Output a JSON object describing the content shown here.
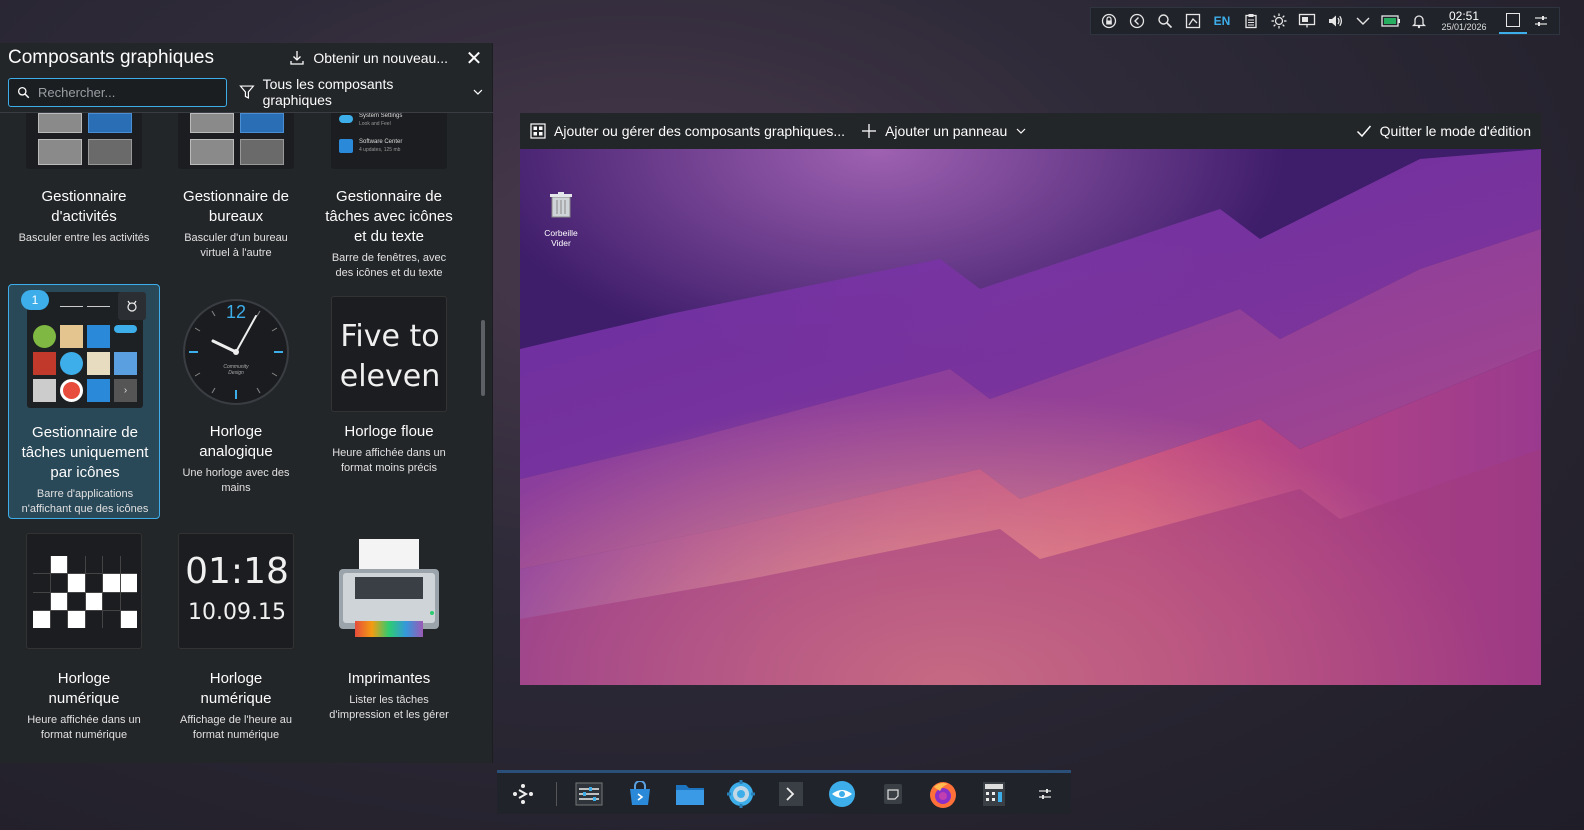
{
  "top_panel": {
    "language": "EN",
    "time": "02:51",
    "date": "25/01/2026",
    "icons": [
      "lock-icon",
      "back-icon",
      "search-icon",
      "screenshot-icon",
      "clipboard-icon",
      "brightness-icon",
      "display-icon",
      "volume-icon",
      "chevron-down-icon",
      "battery-icon",
      "notification-icon",
      "show-desktop-icon",
      "panel-settings-icon"
    ]
  },
  "explorer": {
    "title": "Composants graphiques",
    "get_new_label": "Obtenir un nouveau...",
    "search_placeholder": "Rechercher...",
    "filter_label": "Tous les composants graphiques",
    "selected_badge": "1",
    "widgets": [
      {
        "name": "Gestionnaire d'activités",
        "desc": "Basculer entre les activités"
      },
      {
        "name": "Gestionnaire de bureaux",
        "desc": "Basculer d'un bureau virtuel à l'autre"
      },
      {
        "name": "Gestionnaire de tâches avec icônes et du texte",
        "desc": "Barre de fenêtres, avec des icônes et du texte",
        "thumb_lines": [
          "System Settings",
          "Look and Feel",
          "Software Center",
          "4 updates, 125 mb"
        ]
      },
      {
        "name": "Gestionnaire de tâches uniquement par icônes",
        "desc": "Barre d'applications n'affichant que des icônes"
      },
      {
        "name": "Horloge analogique",
        "desc": "Une horloge avec des mains",
        "thumb_number": "12",
        "thumb_text": "Community Design"
      },
      {
        "name": "Horloge floue",
        "desc": "Heure affichée dans un format moins précis",
        "thumb_line1": "Five to",
        "thumb_line2": "eleven"
      },
      {
        "name": "Horloge numérique",
        "desc": "Heure affichée dans un format numérique"
      },
      {
        "name": "Horloge numérique",
        "desc": "Affichage de l'heure au format numérique",
        "thumb_time": "01:18",
        "thumb_date": "10.09.15"
      },
      {
        "name": "Imprimantes",
        "desc": "Lister les tâches d'impression et les gérer"
      }
    ]
  },
  "editbar": {
    "add_widgets": "Ajouter ou gérer des composants graphiques...",
    "add_panel": "Ajouter un panneau",
    "exit": "Quitter le mode d'édition"
  },
  "desktop": {
    "trash_line1": "Corbeille",
    "trash_line2": "Vider"
  },
  "taskbar": {
    "icons": [
      "application-launcher-icon",
      "system-settings-sliders-icon",
      "software-store-icon",
      "file-manager-icon",
      "system-settings-gear-icon",
      "terminal-icon",
      "browser-icon",
      "note-icon",
      "firefox-icon",
      "calculator-icon",
      "panel-configure-icon"
    ]
  },
  "colors": {
    "accent": "#3daee9",
    "panel": "#232629"
  }
}
